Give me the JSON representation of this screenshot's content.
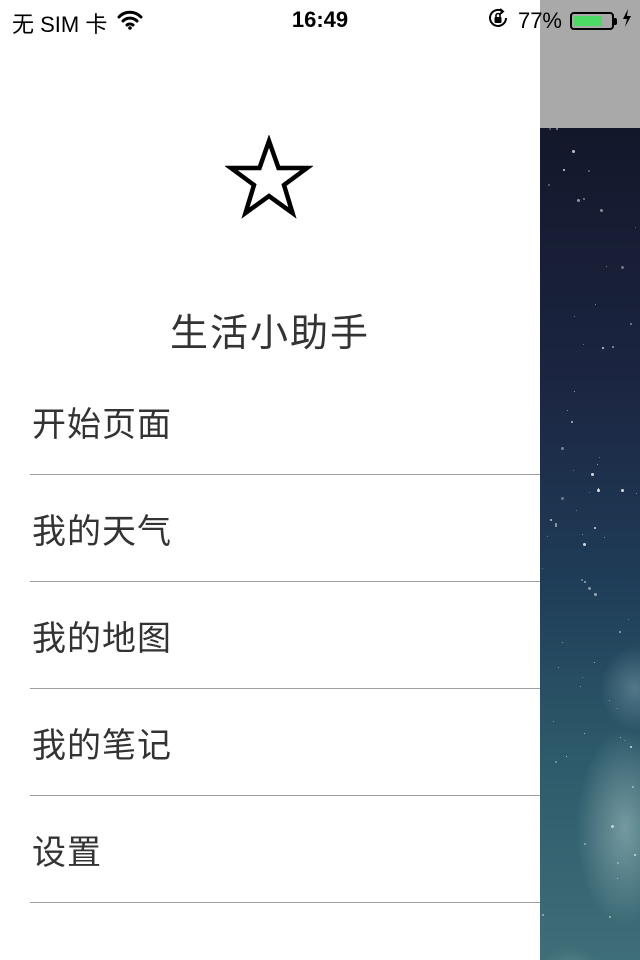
{
  "status_bar": {
    "carrier": "无 SIM 卡",
    "time": "16:49",
    "battery_percent": "77%",
    "battery_level": 0.77,
    "battery_fill_color": "#4cd964"
  },
  "drawer": {
    "app_icon": "star-outline-icon",
    "app_title": "生活小助手",
    "menu_items": [
      {
        "label": "开始页面"
      },
      {
        "label": "我的天气"
      },
      {
        "label": "我的地图"
      },
      {
        "label": "我的笔记"
      },
      {
        "label": "设置"
      }
    ]
  },
  "colors": {
    "menu_text": "#333333",
    "divider": "#9e9e9e",
    "peek_nav": "#a9a9a9"
  }
}
